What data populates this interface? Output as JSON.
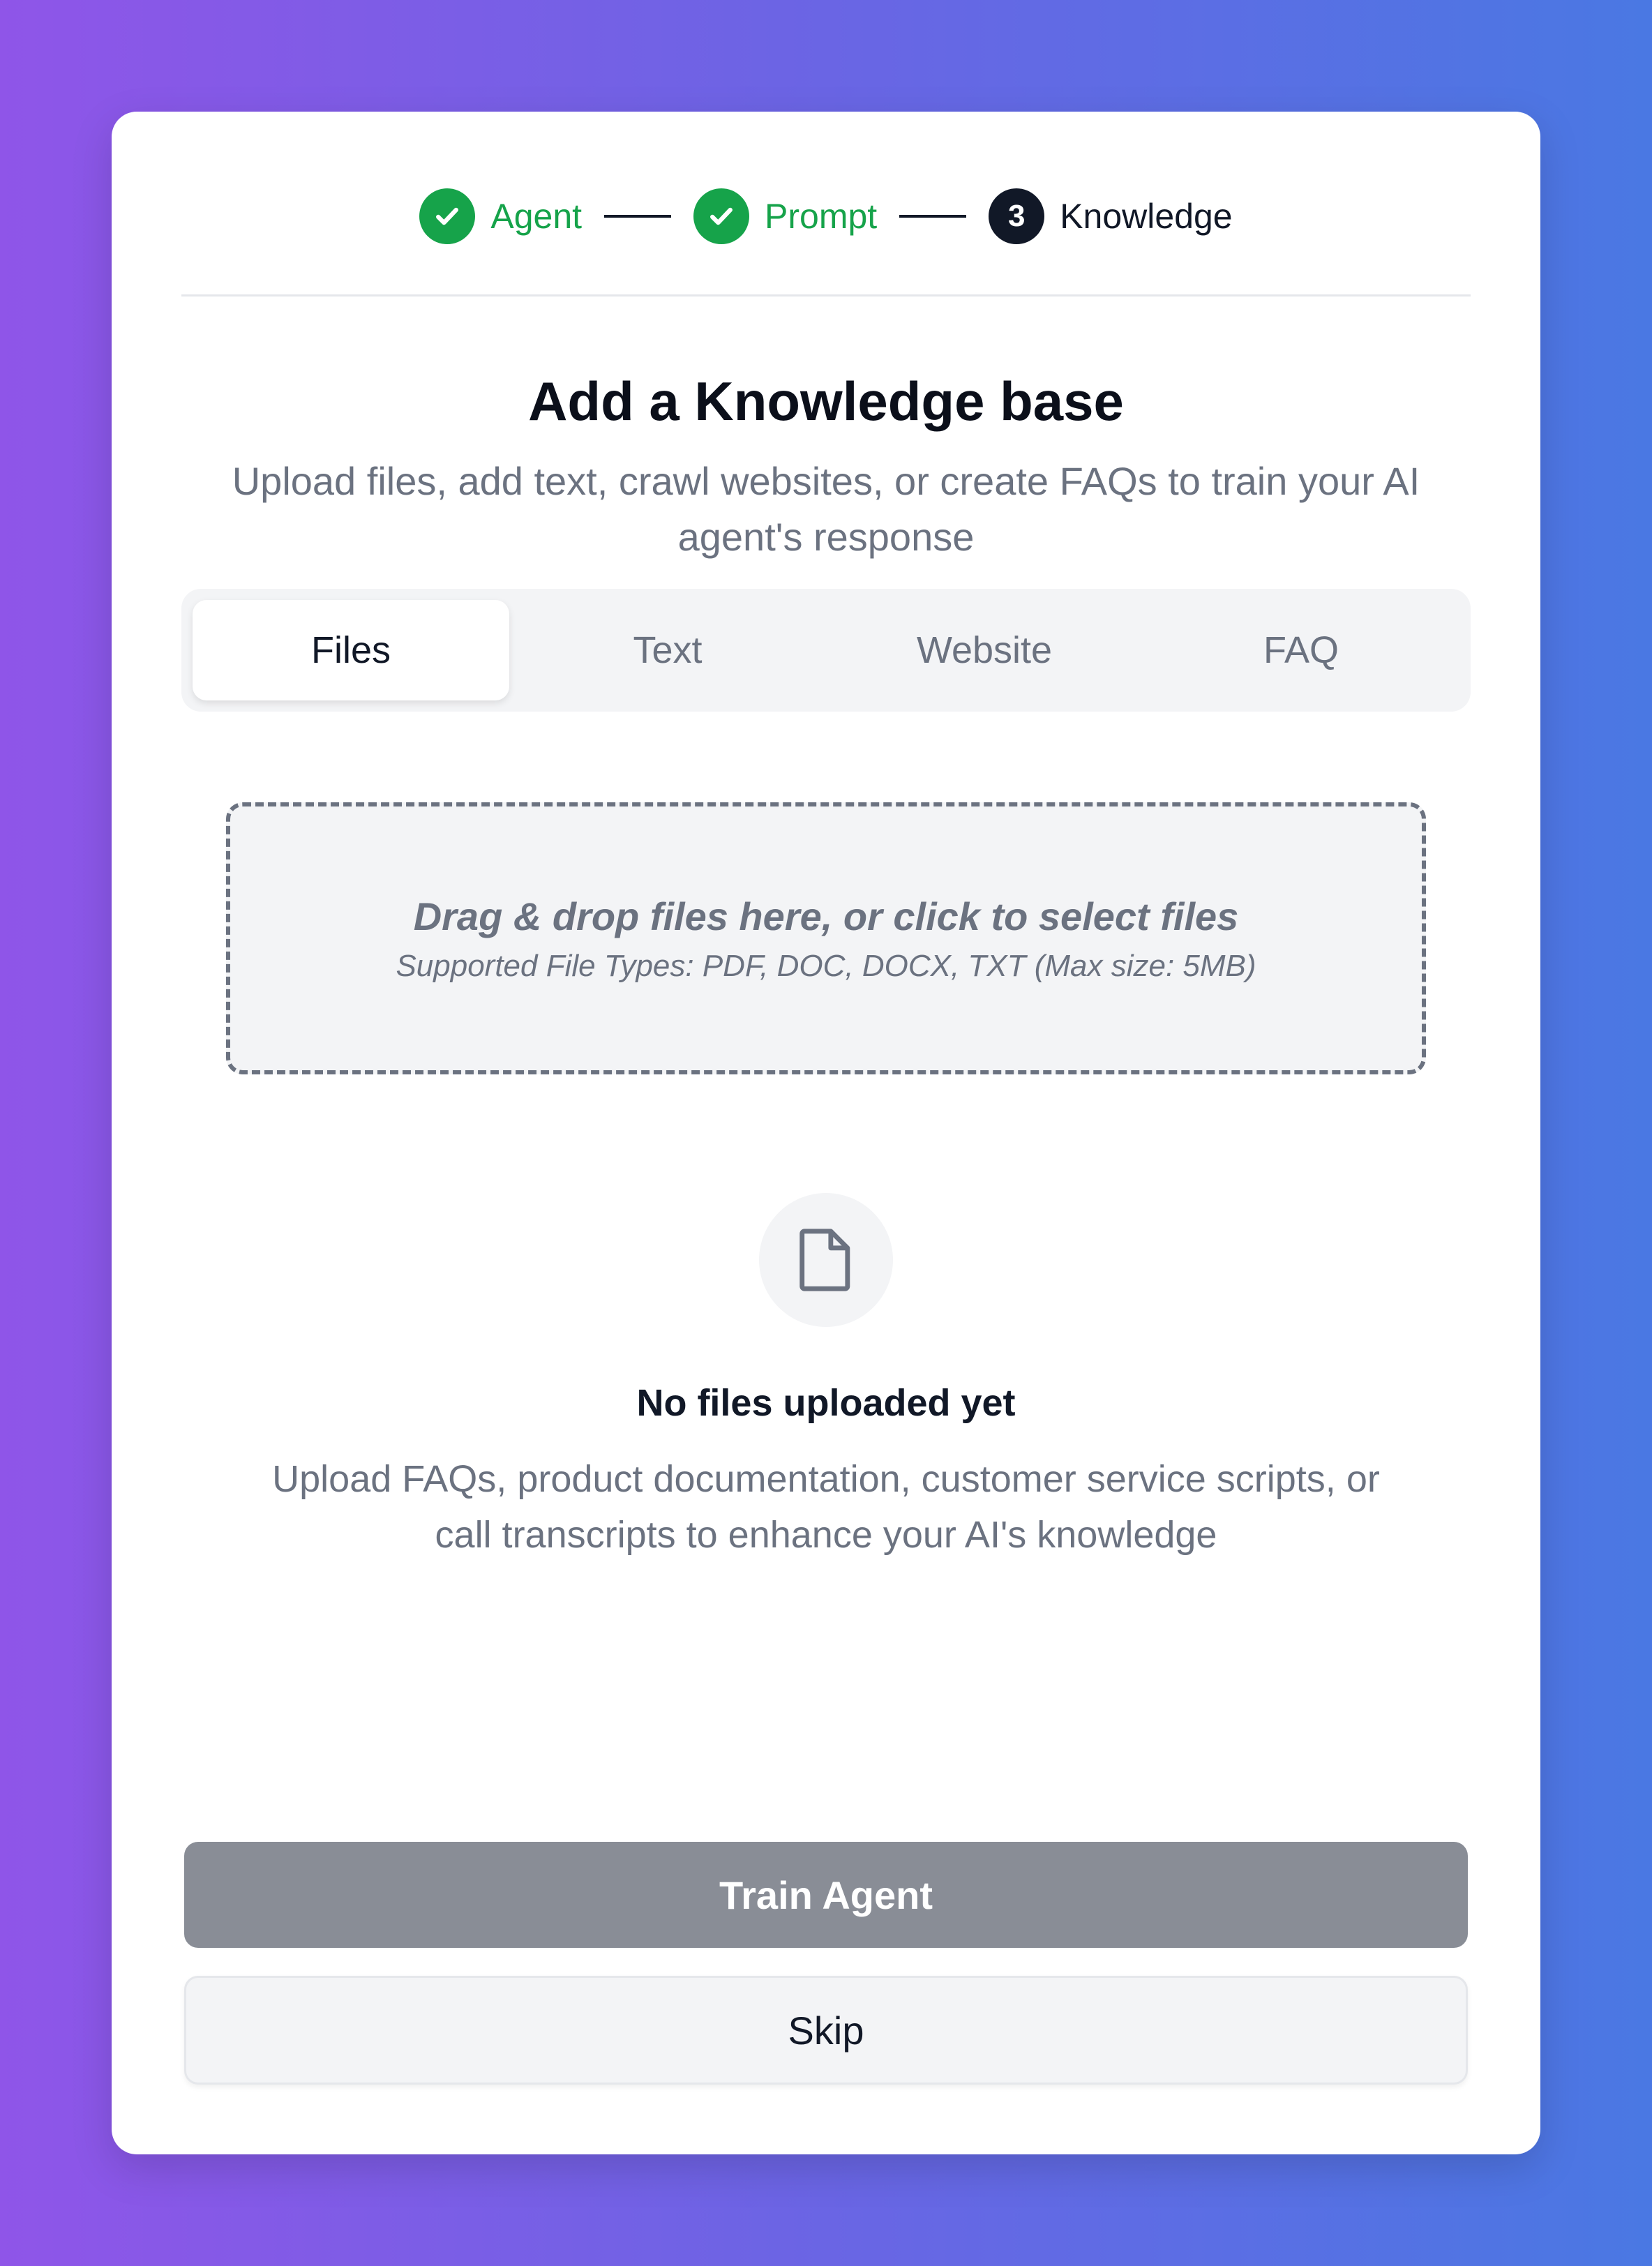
{
  "stepper": {
    "steps": [
      {
        "label": "Agent",
        "state": "done"
      },
      {
        "label": "Prompt",
        "state": "done"
      },
      {
        "label": "Knowledge",
        "state": "active",
        "number": "3"
      }
    ]
  },
  "header": {
    "title": "Add a Knowledge base",
    "subtitle": "Upload files, add text, crawl websites, or create FAQs to train your AI agent's response"
  },
  "tabs": [
    {
      "label": "Files",
      "active": true
    },
    {
      "label": "Text",
      "active": false
    },
    {
      "label": "Website",
      "active": false
    },
    {
      "label": "FAQ",
      "active": false
    }
  ],
  "dropzone": {
    "main": "Drag & drop files here, or click to select files",
    "sub": "Supported File Types: PDF, DOC, DOCX, TXT (Max size: 5MB)"
  },
  "empty_state": {
    "icon": "file-icon",
    "title": "No files uploaded yet",
    "description": "Upload FAQs, product documentation, customer service scripts, or call transcripts to enhance your AI's knowledge"
  },
  "actions": {
    "train_label": "Train Agent",
    "skip_label": "Skip"
  },
  "colors": {
    "success": "#16a34a",
    "active_step": "#111827",
    "muted_text": "#6b7280",
    "train_button": "#898d96"
  }
}
